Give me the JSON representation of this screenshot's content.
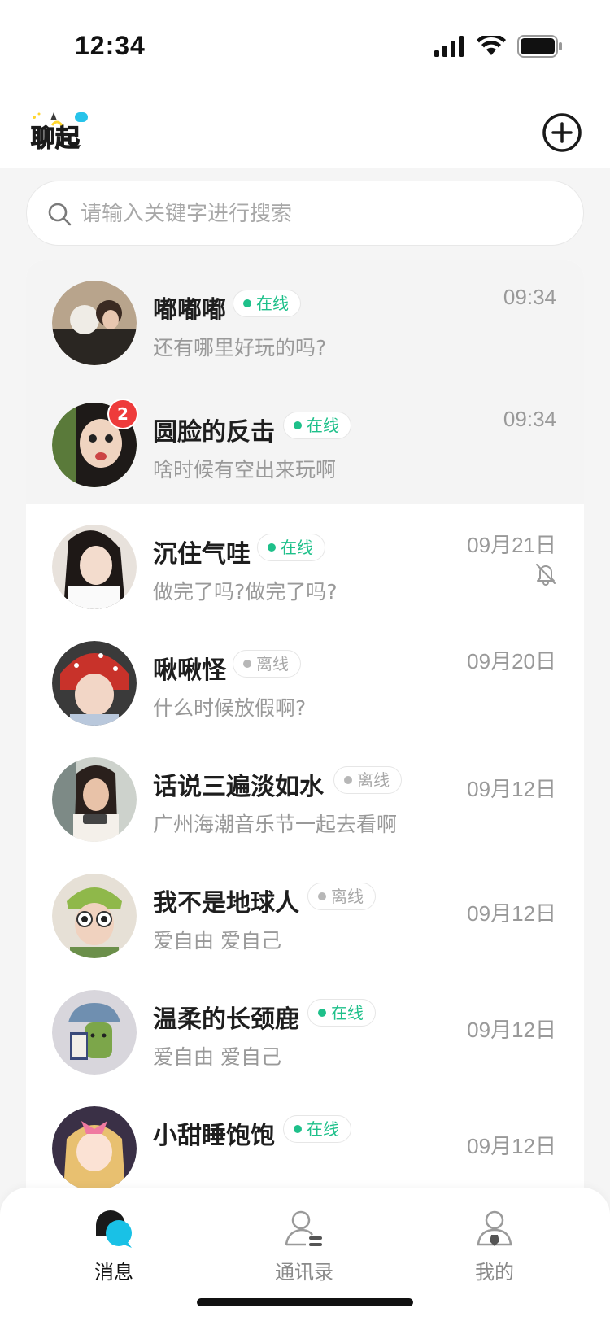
{
  "status_bar": {
    "time": "12:34"
  },
  "header": {
    "logo_text": "聊起",
    "add_icon": "plus-circle-icon"
  },
  "search": {
    "placeholder": "请输入关键字进行搜索",
    "icon": "search-icon"
  },
  "conversations": [
    {
      "name": "嘟嘟嘟",
      "status": "在线",
      "online": true,
      "message": "还有哪里好玩的吗?",
      "time": "09:34",
      "pinned": true
    },
    {
      "name": "圆脸的反击",
      "status": "在线",
      "online": true,
      "message": "啥时候有空出来玩啊",
      "time": "09:34",
      "pinned": true,
      "unread": "2"
    },
    {
      "name": "沉住气哇",
      "status": "在线",
      "online": true,
      "message": "做完了吗?做完了吗?",
      "time": "09月21日",
      "muted": true
    },
    {
      "name": "啾啾怪",
      "status": "离线",
      "online": false,
      "message": "什么时候放假啊?",
      "time": "09月20日"
    },
    {
      "name": "话说三遍淡如水",
      "status": "离线",
      "online": false,
      "message": "广州海潮音乐节一起去看啊",
      "time": "09月12日"
    },
    {
      "name": "我不是地球人",
      "status": "离线",
      "online": false,
      "message": "爱自由 爱自己",
      "time": "09月12日"
    },
    {
      "name": "温柔的长颈鹿",
      "status": "在线",
      "online": true,
      "message": "爱自由 爱自己",
      "time": "09月12日"
    },
    {
      "name": "小甜睡饱饱",
      "status": "在线",
      "online": true,
      "message": "",
      "time": "09月12日"
    }
  ],
  "tabbar": {
    "tabs": [
      {
        "label": "消息",
        "icon": "message-bubble-icon",
        "active": true
      },
      {
        "label": "通讯录",
        "icon": "contacts-icon",
        "active": false
      },
      {
        "label": "我的",
        "icon": "profile-icon",
        "active": false
      }
    ]
  },
  "colors": {
    "online": "#1ec08a",
    "offline": "#a8a8a8",
    "badge": "#ee3b3b",
    "accent": "#19c1e6"
  }
}
